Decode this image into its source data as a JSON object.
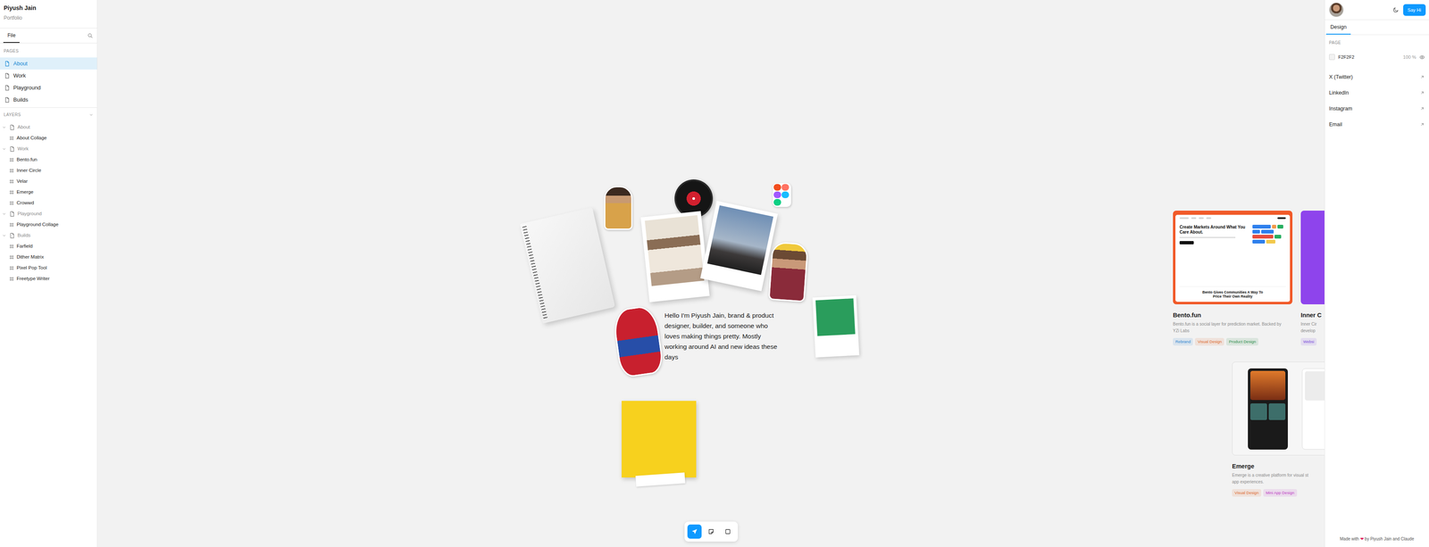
{
  "sidebar": {
    "title": "Piyush Jain",
    "subtitle": "Portfolio",
    "tabs": [
      {
        "label": "File",
        "selected": true
      }
    ],
    "pages_heading": "PAGES",
    "pages": [
      {
        "label": "About",
        "selected": true
      },
      {
        "label": "Work",
        "selected": false
      },
      {
        "label": "Playground",
        "selected": false
      },
      {
        "label": "Builds",
        "selected": false
      }
    ],
    "layers_heading": "LAYERS",
    "layers_expanded": true,
    "layers": [
      {
        "label": "About",
        "kind": "page",
        "expanded": true,
        "children": [
          {
            "label": "About Collage"
          }
        ]
      },
      {
        "label": "Work",
        "kind": "page",
        "expanded": true,
        "children": [
          {
            "label": "Bento.fun"
          },
          {
            "label": "Inner Circle"
          },
          {
            "label": "Velar"
          },
          {
            "label": "Emerge"
          },
          {
            "label": "Crowwd"
          }
        ]
      },
      {
        "label": "Playground",
        "kind": "page",
        "expanded": true,
        "children": [
          {
            "label": "Playground Collage"
          }
        ]
      },
      {
        "label": "Builds",
        "kind": "page",
        "expanded": true,
        "children": [
          {
            "label": "Farfield"
          },
          {
            "label": "Dither Matrix"
          },
          {
            "label": "Pixel Pop Tool"
          },
          {
            "label": "Freetype Writer"
          }
        ]
      }
    ]
  },
  "canvas": {
    "intro": "Hello I'm Piyush Jain, brand & product designer, builder, and someone who loves making things pretty. Mostly working around AI and new ideas these days",
    "projects": [
      {
        "title": "Bento.fun",
        "kind": "website",
        "color": "#f15a29",
        "thumb_texts": [
          "Create Markets Around What You Care About.",
          "Bento Gives Communities A Way To Price Their Own Reality"
        ],
        "description": [
          "Bento.fun is a social layer for prediction market. Backed by",
          "YZi Labs"
        ],
        "tags": [
          {
            "label": "Rebrand",
            "color": "#2f86d1"
          },
          {
            "label": "Visual Design",
            "color": "#dd6b2f"
          },
          {
            "label": "Product Design",
            "color": "#2f8f4e"
          }
        ]
      },
      {
        "title": "Inner C",
        "kind": "plain",
        "color": "#8e44ec",
        "thumb_texts": [],
        "description": [
          "Inner Cir",
          "develop"
        ],
        "tags": [
          {
            "label": "Websi",
            "color": "#7c4ddb"
          }
        ]
      },
      {
        "title": "Emerge",
        "kind": "phones",
        "color": "#f6f6f6",
        "thumb_texts": [],
        "description": [
          "Emerge is a creative platform for visual st",
          "app experiences."
        ],
        "tags": [
          {
            "label": "Visual Design",
            "color": "#dd6b2f"
          },
          {
            "label": "Mini App Design",
            "color": "#bf3fc6"
          }
        ]
      }
    ],
    "tools": [
      {
        "kind": "move",
        "selected": true
      },
      {
        "kind": "note",
        "selected": false
      },
      {
        "kind": "frame",
        "selected": false
      }
    ]
  },
  "panel": {
    "button": "Say Hi",
    "tabs": [
      {
        "label": "Design",
        "selected": true
      }
    ],
    "page_heading": "PAGE",
    "page_fill": {
      "hex": "F2F2F2",
      "opacity": "100 %",
      "visible": true
    },
    "links": [
      "X (Twitter)",
      "LinkedIn",
      "Instagram",
      "Email"
    ],
    "footer": {
      "before": "Made with",
      "heart": "❤",
      "after": "by Piyush Jain and Claude"
    }
  }
}
